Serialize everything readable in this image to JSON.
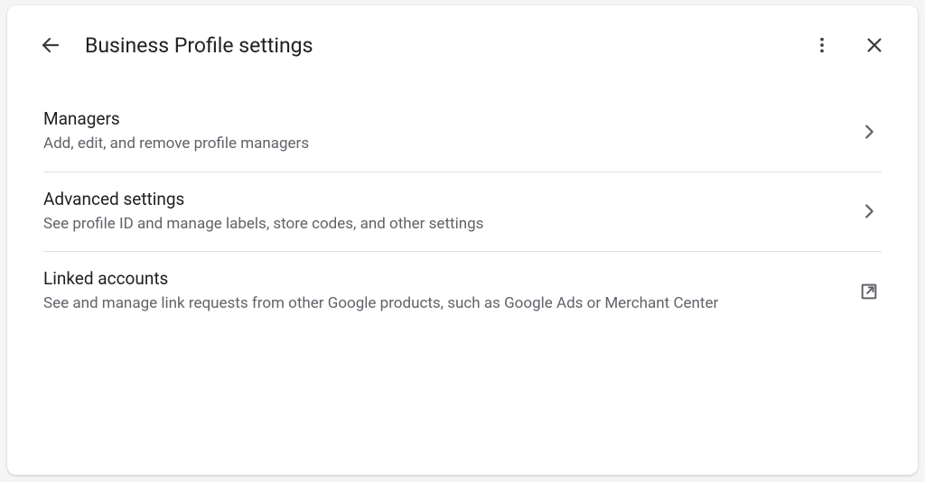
{
  "header": {
    "title": "Business Profile settings"
  },
  "items": [
    {
      "title": "Managers",
      "desc": "Add, edit, and remove profile managers",
      "icon": "chevron"
    },
    {
      "title": "Advanced settings",
      "desc": "See profile ID and manage labels, store codes, and other settings",
      "icon": "chevron"
    },
    {
      "title": "Linked accounts",
      "desc": "See and manage link requests from other Google products, such as Google Ads or Merchant Center",
      "icon": "external"
    }
  ]
}
